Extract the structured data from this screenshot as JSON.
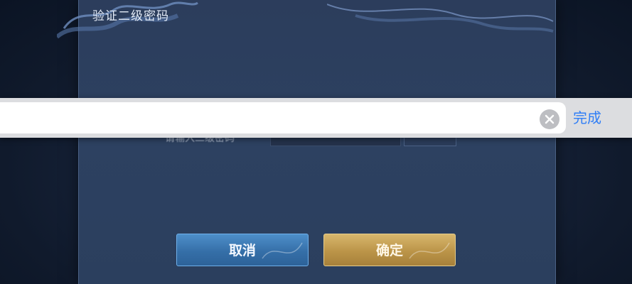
{
  "dialog": {
    "title": "验证二级密码",
    "field_label": "请输入二级密码"
  },
  "keyboard_bar": {
    "input_value": "",
    "clear_icon": "clear-circle-icon",
    "done_label": "完成",
    "done_color": "#2f7ef6"
  },
  "buttons": {
    "cancel_label": "取消",
    "confirm_label": "确定",
    "cancel_color": "#3a78b4",
    "confirm_color": "#c39d50"
  }
}
